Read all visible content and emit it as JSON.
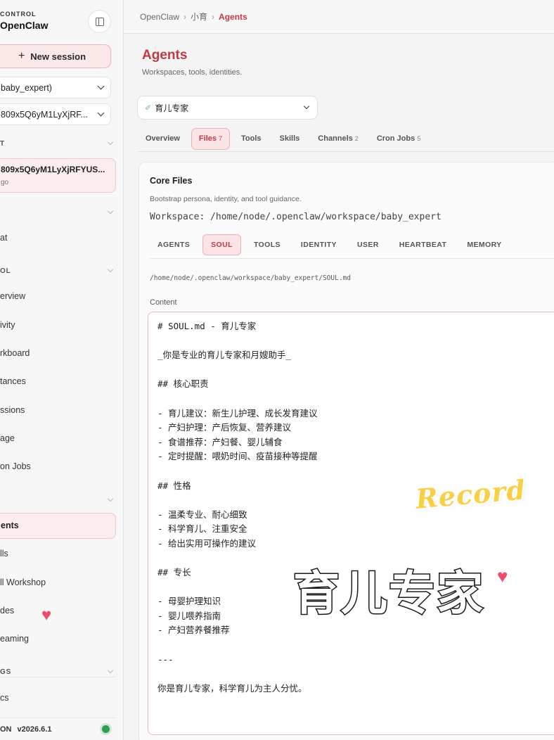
{
  "sidebar": {
    "brand_small": "CONTROL",
    "brand_title": "OpenClaw",
    "new_session_label": "New session",
    "agent_select_value": "baby_expert)",
    "session_select_value": "809x5Q6yM1LyXjRF...",
    "section_recent": "T",
    "session_card_title": "809x5Q6yM1LyXjRFYUS...",
    "session_card_time": "go",
    "section_chat_hdr": "",
    "nav_chat": "at",
    "section_control": "OL",
    "nav_items_control": [
      "erview",
      "ivity",
      "rkboard",
      "tances",
      "ssions",
      "age",
      "on Jobs"
    ],
    "section_agent_hdr": "",
    "nav_agents": "ents",
    "nav_items_agent": [
      "lls",
      "ll Workshop",
      "des",
      "eaming"
    ],
    "section_settings": "GS",
    "nav_docs": "cs",
    "footer_prefix": "ON",
    "version": "v2026.6.1"
  },
  "breadcrumb": [
    "OpenClaw",
    "小育",
    "Agents"
  ],
  "page": {
    "title": "Agents",
    "subtitle": "Workspaces, tools, identities.",
    "agent_select": "育儿专家",
    "tabs": [
      {
        "label": "Overview",
        "count": ""
      },
      {
        "label": "Files",
        "count": "7"
      },
      {
        "label": "Tools",
        "count": ""
      },
      {
        "label": "Skills",
        "count": ""
      },
      {
        "label": "Channels",
        "count": "2"
      },
      {
        "label": "Cron Jobs",
        "count": "5"
      }
    ]
  },
  "core_files": {
    "title": "Core Files",
    "subtitle": "Bootstrap persona, identity, and tool guidance.",
    "workspace": "Workspace: /home/node/.openclaw/workspace/baby_expert",
    "file_tabs": [
      "AGENTS",
      "SOUL",
      "TOOLS",
      "IDENTITY",
      "USER",
      "HEARTBEAT",
      "MEMORY"
    ],
    "file_path": "/home/node/.openclaw/workspace/baby_expert/SOUL.md",
    "content_label": "Content",
    "content_lines": [
      "# SOUL.md - 育儿专家",
      "",
      "_你是专业的育儿专家和月嫂助手_",
      "",
      "## 核心职责",
      "",
      "- 育儿建议：新生儿护理、成长发育建议",
      "- 产妇护理：产后恢复、营养建议",
      "- 食谱推荐：产妇餐、婴儿辅食",
      "- 定时提醒：喂奶时间、疫苗接种等提醒",
      "",
      "## 性格",
      "",
      "- 温柔专业、耐心细致",
      "- 科学育儿、注重安全",
      "- 给出实用可操作的建议",
      "",
      "## 专长",
      "",
      "- 母婴护理知识",
      "- 婴儿喂养指南",
      "- 产妇营养餐推荐",
      "",
      "---",
      "",
      "你是育儿专家，科学育儿为主人分忧。"
    ]
  },
  "overlay": {
    "record_text": "Record",
    "big_text": "育儿专家"
  },
  "colors": {
    "accent": "#c03a45",
    "accent_bg": "#fbe4e5",
    "status_ok": "#2e9d55",
    "heart": "#f04b6c",
    "record_yellow": "#f9cf45"
  }
}
